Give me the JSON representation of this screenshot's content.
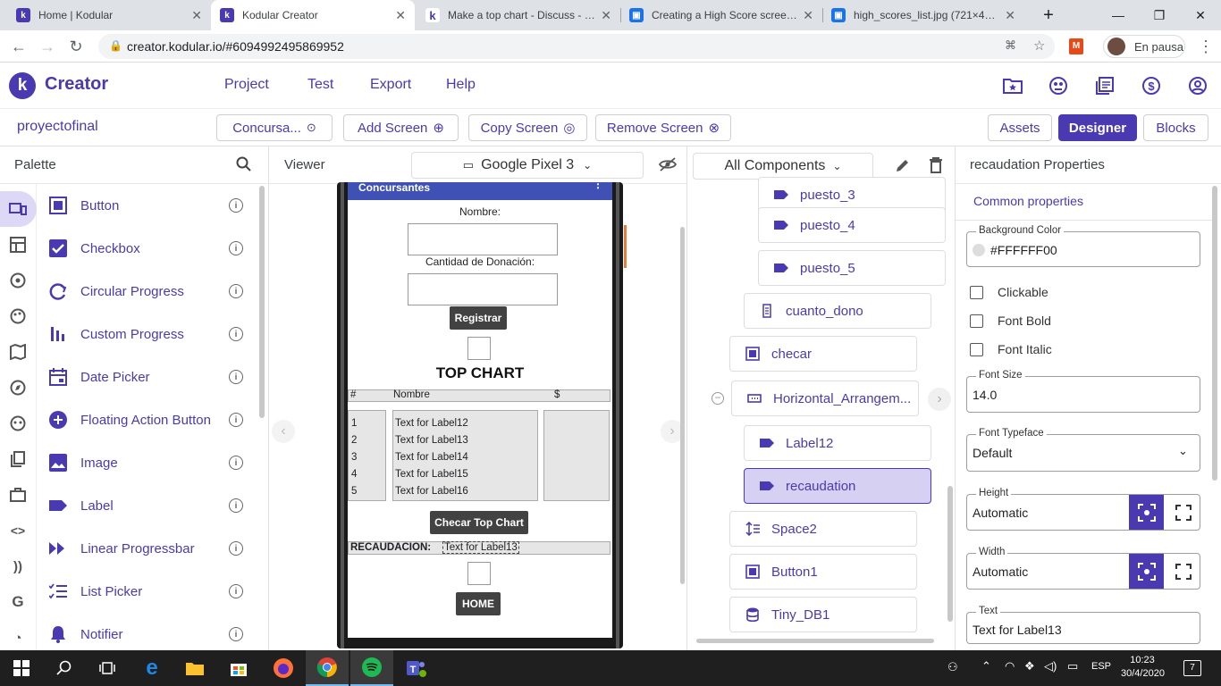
{
  "browser": {
    "tabs": [
      {
        "title": "Home | Kodular",
        "active": false
      },
      {
        "title": "Kodular Creator",
        "active": true
      },
      {
        "title": "Make a top chart - Discuss - Ko",
        "active": false
      },
      {
        "title": "Creating a High Score screen w",
        "active": false
      },
      {
        "title": "high_scores_list.jpg (721×470)",
        "active": false
      }
    ],
    "url": "creator.kodular.io/#6094992495869952",
    "profile_label": "En pausa"
  },
  "app": {
    "brand": "Creator",
    "menu": [
      "Project",
      "Test",
      "Export",
      "Help"
    ]
  },
  "project": {
    "name": "proyectofinal",
    "screen_select": "Concursa...",
    "add_screen": "Add Screen",
    "copy_screen": "Copy Screen",
    "remove_screen": "Remove Screen",
    "assets": "Assets",
    "designer": "Designer",
    "blocks": "Blocks"
  },
  "palette": {
    "title": "Palette",
    "items": [
      {
        "label": "Button",
        "icon": "button-icon"
      },
      {
        "label": "Checkbox",
        "icon": "checkbox-icon"
      },
      {
        "label": "Circular Progress",
        "icon": "circular-progress-icon"
      },
      {
        "label": "Custom Progress",
        "icon": "custom-progress-icon"
      },
      {
        "label": "Date Picker",
        "icon": "date-picker-icon"
      },
      {
        "label": "Floating Action Button",
        "icon": "fab-icon"
      },
      {
        "label": "Image",
        "icon": "image-icon"
      },
      {
        "label": "Label",
        "icon": "label-icon"
      },
      {
        "label": "Linear Progressbar",
        "icon": "linear-progress-icon"
      },
      {
        "label": "List Picker",
        "icon": "list-picker-icon"
      },
      {
        "label": "Notifier",
        "icon": "notifier-icon"
      }
    ]
  },
  "viewer": {
    "title": "Viewer",
    "device": "Google Pixel 3",
    "phone": {
      "titlebar": "Concursantes",
      "nombre_label": "Nombre:",
      "donacion_label": "Cantidad de Donación:",
      "registrar": "Registrar",
      "top_chart": "TOP CHART",
      "col_num": "#",
      "col_nombre": "Nombre",
      "col_dollar": "$",
      "nums": [
        "1",
        "2",
        "3",
        "4",
        "5"
      ],
      "names": [
        "Text for Label12",
        "Text for Label13",
        "Text for Label14",
        "Text for Label15",
        "Text for Label16"
      ],
      "checar": "Checar Top Chart",
      "recaudacion_label": "RECAUDACION:",
      "recaudacion_value": "Text for Label13",
      "home": "HOME"
    }
  },
  "components": {
    "title": "All Components",
    "items": [
      {
        "label": "puesto_3",
        "icon": "label-icon"
      },
      {
        "label": "puesto_4",
        "icon": "label-icon"
      },
      {
        "label": "puesto_5",
        "icon": "label-icon"
      },
      {
        "label": "cuanto_dono",
        "icon": "textbox-icon"
      },
      {
        "label": "checar",
        "icon": "button-icon"
      },
      {
        "label": "Horizontal_Arrangem...",
        "icon": "horizontal-arrangement-icon"
      },
      {
        "label": "Label12",
        "icon": "label-icon"
      },
      {
        "label": "recaudation",
        "icon": "label-icon",
        "selected": true
      },
      {
        "label": "Space2",
        "icon": "space-icon"
      },
      {
        "label": "Button1",
        "icon": "button-icon"
      },
      {
        "label": "Tiny_DB1",
        "icon": "database-icon"
      }
    ]
  },
  "properties": {
    "title": "recaudation Properties",
    "common": "Common properties",
    "background_color_label": "Background Color",
    "background_color_value": "#FFFFFF00",
    "clickable": "Clickable",
    "font_bold": "Font Bold",
    "font_italic": "Font Italic",
    "font_size_label": "Font Size",
    "font_size_value": "14.0",
    "font_typeface_label": "Font Typeface",
    "font_typeface_value": "Default",
    "height_label": "Height",
    "height_value": "Automatic",
    "width_label": "Width",
    "width_value": "Automatic",
    "text_label": "Text",
    "text_value": "Text for Label13"
  },
  "taskbar": {
    "lang": "ESP",
    "time": "10:23",
    "date": "30/4/2020",
    "notif_count": "7"
  },
  "colors": {
    "accent": "#4a3ab1",
    "selected_bg": "#d6d0f2",
    "phone_titlebar": "#3f51b5"
  }
}
